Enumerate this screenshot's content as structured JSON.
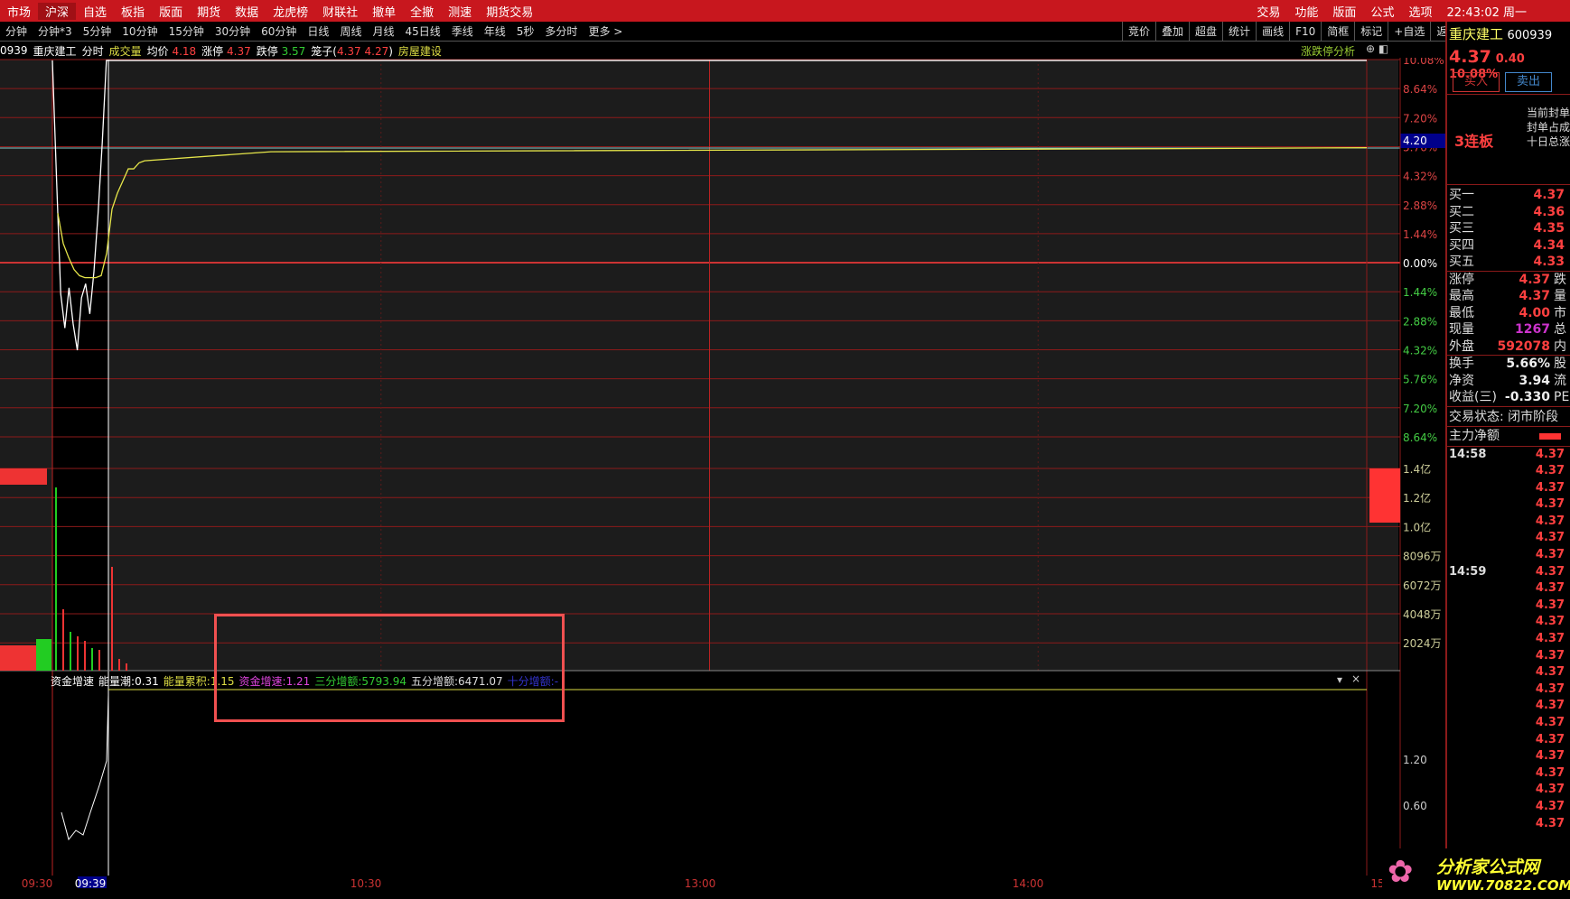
{
  "menu": {
    "items": [
      "市场",
      "沪深",
      "自选",
      "板指",
      "版面",
      "期货",
      "数据",
      "龙虎榜",
      "财联社",
      "撤单",
      "全撤",
      "测速",
      "期货交易"
    ],
    "right": [
      "交易",
      "功能",
      "版面",
      "公式",
      "选项"
    ],
    "clock": "22:43:02 周一"
  },
  "periods": [
    "分钟",
    "分钟*3",
    "5分钟",
    "10分钟",
    "15分钟",
    "30分钟",
    "60分钟",
    "日线",
    "周线",
    "月线",
    "45日线",
    "季线",
    "年线",
    "5秒",
    "多分时",
    "更多 >"
  ],
  "tools": [
    "竞价",
    "叠加",
    "超盘",
    "统计",
    "画线",
    "F10",
    "简框",
    "标记",
    "+自选",
    "返回"
  ],
  "info": {
    "code": "0939",
    "name": "重庆建工",
    "mode": "分时",
    "vol_label": "成交量",
    "avg_label": "均价",
    "avg": "4.18",
    "zt_label": "涨停",
    "zt": "4.37",
    "dt_label": "跌停",
    "dt": "3.57",
    "cage_label": "笼子(",
    "cage_hi": "4.37",
    "cage_lo": "4.27",
    "cage_end": ")",
    "sector": "房屋建设",
    "analysis": "涨跌停分析"
  },
  "pct_axis": [
    "10.08%",
    "8.64%",
    "7.20%",
    "5.76%",
    "4.32%",
    "2.88%",
    "1.44%",
    "0.00%",
    "1.44%",
    "2.88%",
    "4.32%",
    "5.76%",
    "7.20%",
    "8.64%"
  ],
  "price_tag": "4.20",
  "vol_axis": [
    "1.4亿",
    "1.2亿",
    "1.0亿",
    "8096万",
    "6072万",
    "4048万",
    "2024万"
  ],
  "ind_axis": [
    "1.20",
    "0.60"
  ],
  "time_axis": [
    "09:30",
    "09:39",
    "10:30",
    "13:00",
    "14:00",
    "15"
  ],
  "indicator": {
    "name": "资金增速",
    "a_label": "能量潮:",
    "a": "0.31",
    "b_label": "能量累积:",
    "b": "1.15",
    "c_label": "资金增速:",
    "c": "1.21",
    "d_label": "三分增额:",
    "d": "5793.94",
    "e_label": "五分增额:",
    "e": "6471.07",
    "f_label": "十分增额:",
    "f": "-"
  },
  "price_series_pct": [
    10.08,
    4.2,
    -1.5,
    -3.2,
    -1.2,
    -3.0,
    -4.3,
    -1.7,
    -1.0,
    -2.5,
    -0.4,
    2.5,
    6.0,
    10.08
  ],
  "avg_series_pct": [
    2.5,
    1.0,
    0.3,
    -0.3,
    -0.6,
    -0.7,
    -0.7,
    -0.7,
    -0.6,
    0.5,
    2.7,
    3.5,
    4.1,
    4.7,
    4.7,
    5.0,
    5.1
  ],
  "quote": {
    "name": "重庆建工",
    "code": "600939",
    "price": "4.37",
    "change": "0.40",
    "pct": "10.08%",
    "buy": "买入",
    "sell": "卖出",
    "streak": "3连板",
    "notes": [
      "当前封单",
      "封单占成",
      "十日总涨"
    ],
    "bids": [
      [
        "买一",
        "4.37"
      ],
      [
        "买二",
        "4.36"
      ],
      [
        "买三",
        "4.35"
      ],
      [
        "买四",
        "4.34"
      ],
      [
        "买五",
        "4.33"
      ]
    ],
    "stats": [
      [
        "涨停",
        "4.37",
        "跌"
      ],
      [
        "最高",
        "4.37",
        "量"
      ],
      [
        "最低",
        "4.00",
        "市"
      ],
      [
        "现量",
        "1267",
        "总"
      ],
      [
        "外盘",
        "592078",
        "内"
      ]
    ],
    "stats2": [
      [
        "换手",
        "5.66%",
        "股"
      ],
      [
        "净资",
        "3.94",
        "流"
      ],
      [
        "收益(三)",
        "-0.330",
        "PE"
      ]
    ],
    "status": "交易状态: 闭市阶段",
    "main_net": "主力净额",
    "ticks": [
      {
        "time": "14:58",
        "price": "4.37"
      },
      {
        "price": "4.37"
      },
      {
        "price": "4.37"
      },
      {
        "price": "4.37"
      },
      {
        "price": "4.37"
      },
      {
        "price": "4.37"
      },
      {
        "price": "4.37"
      },
      {
        "time": "14:59",
        "price": "4.37"
      },
      {
        "price": "4.37"
      },
      {
        "price": "4.37"
      },
      {
        "price": "4.37"
      },
      {
        "price": "4.37"
      },
      {
        "price": "4.37"
      },
      {
        "price": "4.37"
      },
      {
        "price": "4.37"
      },
      {
        "price": "4.37"
      },
      {
        "price": "4.37"
      },
      {
        "price": "4.37"
      },
      {
        "price": "4.37"
      },
      {
        "price": "4.37"
      },
      {
        "price": "4.37"
      },
      {
        "price": "4.37"
      },
      {
        "price": "4.37"
      }
    ]
  },
  "logo": {
    "cn": "分析家公式网",
    "url": "WWW.70822.COM"
  },
  "colors": {
    "up": "#ff4040",
    "down": "#33cc33",
    "menu": "#c8171e",
    "grid": "#8b1a1a",
    "avg": "#e6e64a",
    "highlight": "#f05050"
  }
}
